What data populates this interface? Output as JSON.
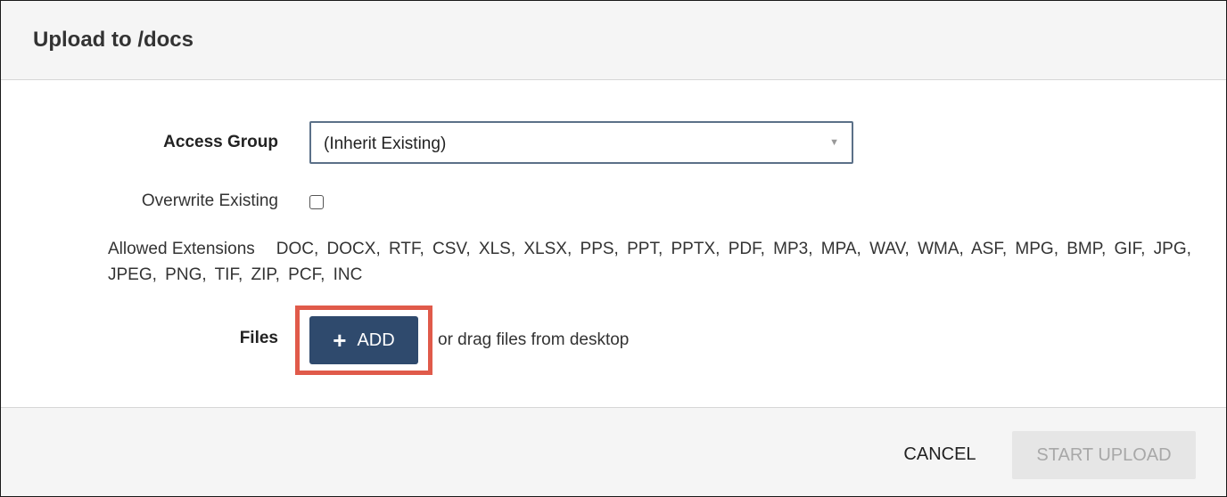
{
  "dialog": {
    "title": "Upload to /docs"
  },
  "form": {
    "access_group": {
      "label": "Access Group",
      "value": "(Inherit Existing)",
      "arrow_icon": "caret-down-icon"
    },
    "overwrite": {
      "label": "Overwrite Existing",
      "checked": false
    },
    "extensions": {
      "label": "Allowed Extensions",
      "value": "DOC, DOCX, RTF, CSV, XLS, XLSX, PPS, PPT, PPTX, PDF, MP3, MPA, WAV, WMA, ASF, MPG, BMP, GIF, JPG, JPEG, PNG, TIF, ZIP, PCF, INC"
    },
    "files": {
      "label": "Files",
      "add_label": "ADD",
      "add_icon": "plus-icon",
      "drag_text": "or drag files from desktop"
    }
  },
  "footer": {
    "cancel_label": "CANCEL",
    "start_label": "START UPLOAD"
  },
  "colors": {
    "primary": "#2f4a6d",
    "highlight": "#e05a4a",
    "disabled_bg": "#e6e6e6",
    "disabled_text": "#a8a8a8"
  }
}
